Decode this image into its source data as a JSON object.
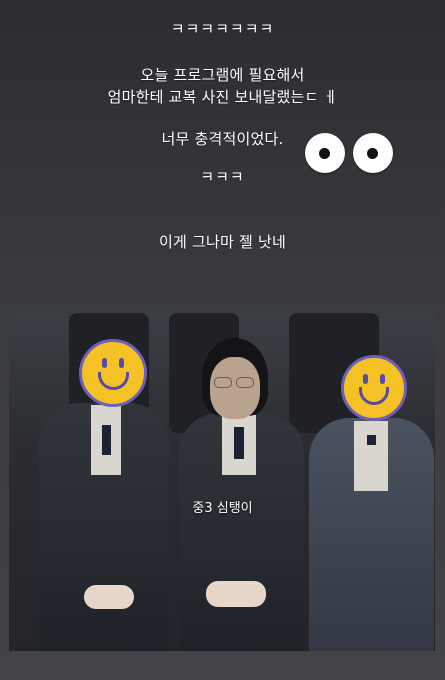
{
  "story": {
    "laugh_top": "ㅋㅋㅋㅋㅋㅋㅋ",
    "line1": "오늘 프로그램에 필요해서",
    "line2": "엄마한테 교복 사진 보내달랬는ㄷ ㅔ",
    "line3": "너무 충격적이었다.",
    "laugh_mid": "ㅋㅋㅋ",
    "line4": "이게 그나마 젤 낫네",
    "photo_caption": "중3 심탱이"
  },
  "stickers": {
    "eyes": "eyes-icon",
    "smiley": "smiley-face-icon"
  },
  "colors": {
    "background_top": "#2c2d30",
    "background_bottom": "#434447",
    "text": "#ffffff",
    "smiley_fill": "#f5c226",
    "smiley_outline": "#6f5fb8"
  }
}
